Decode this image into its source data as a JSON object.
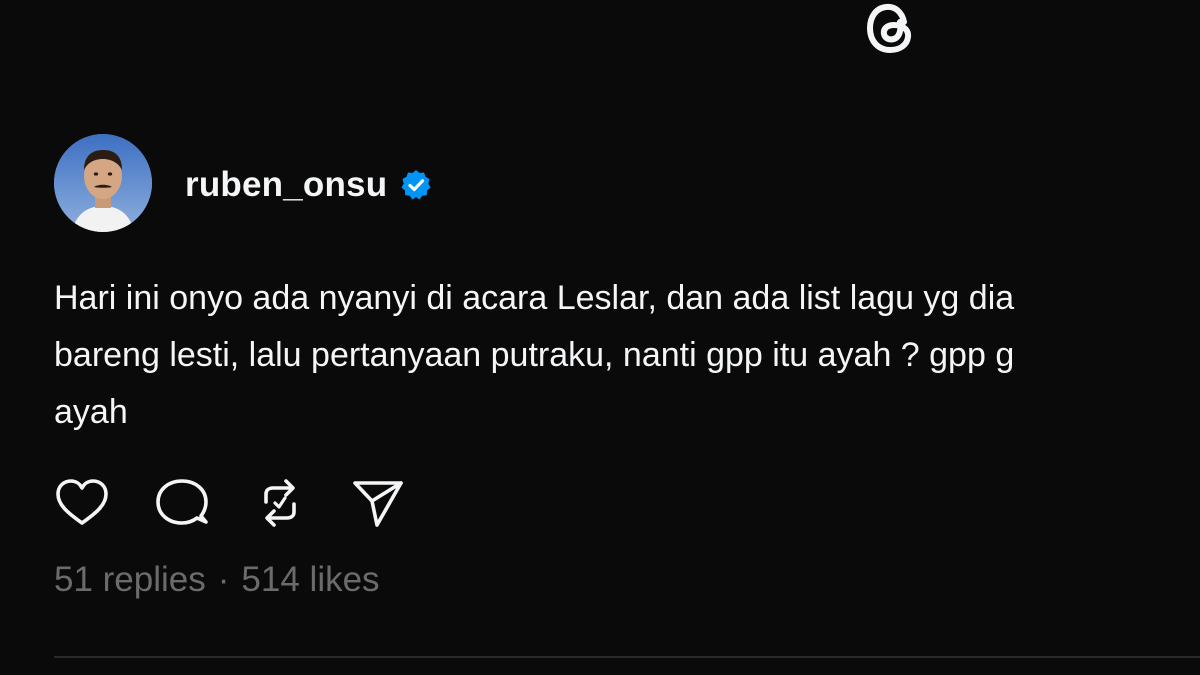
{
  "app": {
    "logo": "threads-logo-icon"
  },
  "post": {
    "author": {
      "username": "ruben_onsu",
      "verified": true,
      "avatar": "avatar-photo"
    },
    "text_lines": [
      "Hari ini onyo ada nyanyi di acara Leslar, dan ada list lagu yg dia",
      "bareng lesti, lalu pertanyaan putraku, nanti gpp itu ayah ? gpp g",
      "ayah"
    ],
    "actions": {
      "like_icon": "heart-icon",
      "reply_icon": "comment-icon",
      "repost_icon": "repost-icon",
      "share_icon": "send-icon"
    },
    "stats": {
      "replies": "51 replies",
      "separator": "·",
      "likes": "514 likes"
    }
  },
  "colors": {
    "background": "#0a0a0a",
    "text": "#f3f5f7",
    "muted": "#6b6b6b",
    "verified_blue": "#0095f6"
  }
}
